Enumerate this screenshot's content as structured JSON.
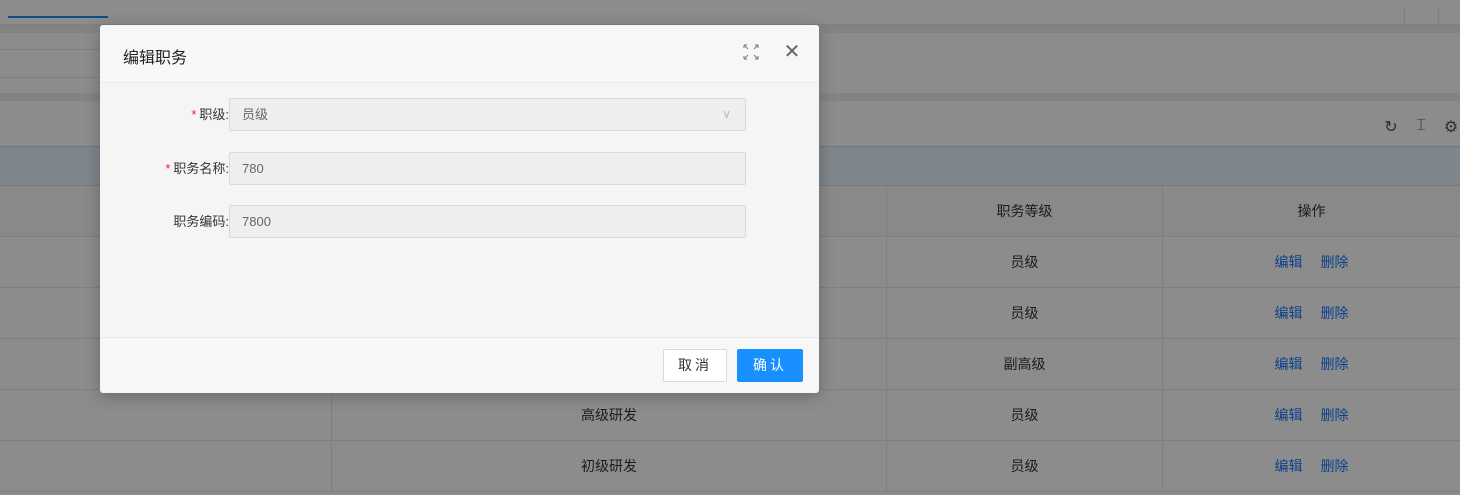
{
  "toolbar": {
    "icons": [
      "refresh-icon",
      "column-height-icon",
      "setting-icon"
    ]
  },
  "table": {
    "headers": [
      "",
      "",
      "职务等级",
      "操作"
    ],
    "rows": [
      {
        "name": "",
        "grade": "员级"
      },
      {
        "name": "",
        "grade": "员级"
      },
      {
        "name": "",
        "grade": "副高级"
      },
      {
        "name": "高级研发",
        "grade": "员级"
      },
      {
        "name": "初级研发",
        "grade": "员级"
      }
    ],
    "actions": {
      "edit": "编辑",
      "delete": "删除"
    }
  },
  "modal": {
    "title": "编辑职务",
    "fields": {
      "level": {
        "label": "职级:",
        "required": true,
        "value": "员级"
      },
      "name": {
        "label": "职务名称:",
        "required": true,
        "value": "780"
      },
      "code": {
        "label": "职务编码:",
        "required": false,
        "value": "7800"
      }
    },
    "required_mark": "*",
    "cancel_label": "取消",
    "ok_label": "确认"
  },
  "colors": {
    "primary": "#1890ff",
    "required": "#f5222d"
  }
}
